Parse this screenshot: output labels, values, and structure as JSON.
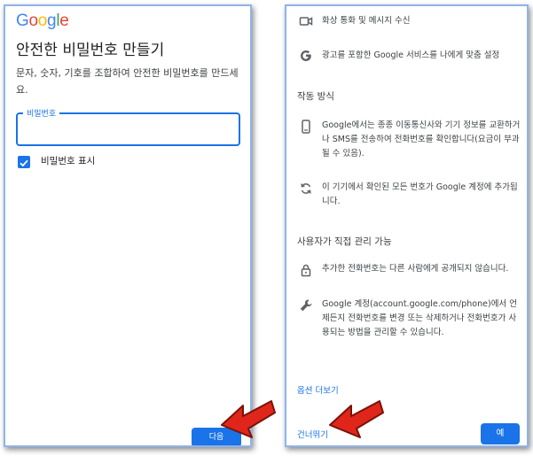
{
  "left_panel": {
    "logo": [
      "G",
      "o",
      "o",
      "g",
      "l",
      "e"
    ],
    "logo_colors": [
      "#4285F4",
      "#EA4335",
      "#FBBC05",
      "#4285F4",
      "#34A853",
      "#EA4335"
    ],
    "title": "안전한 비밀번호 만들기",
    "description": "문자, 숫자, 기호를 조합하여 안전한 비밀번호를 만드세요.",
    "password_label": "비밀번호",
    "password_value": "",
    "show_password_label": "비밀번호 표시",
    "show_password_checked": true,
    "next_button": "다음"
  },
  "right_panel": {
    "items_top": [
      {
        "icon": "video-call-icon",
        "text": "화상 통화 및 메시지 수신"
      },
      {
        "icon": "google-g-icon",
        "text": "광고를 포함한 Google 서비스를 나에게 맞춤 설정"
      }
    ],
    "section_how": "작동 방식",
    "items_how": [
      {
        "icon": "phone-icon",
        "text": "Google에서는 종종 이동통신사와 기기 정보를 교환하거나 SMS를 전송하여 전화번호를 확인합니다(요금이 부과될 수 있음)."
      },
      {
        "icon": "sync-icon",
        "text": "이 기기에서 확인된 모든 번호가 Google 계정에 추가됩니다."
      }
    ],
    "section_control": "사용자가 직접 관리 가능",
    "items_control": [
      {
        "icon": "lock-icon",
        "text": "추가한 전화번호는 다른 사람에게 공개되지 않습니다."
      },
      {
        "icon": "wrench-icon",
        "text": "Google 계정(account.google.com/phone)에서 언제든지 전화번호를 변경 또는 삭제하거나 전화번호가 사용되는 방법을 관리할 수 있습니다."
      }
    ],
    "more_options_link": "옵션 더보기",
    "skip_link": "건너뛰기",
    "yes_button": "예"
  },
  "colors": {
    "accent": "#1a73e8",
    "arrow_red": "#e0261b"
  }
}
